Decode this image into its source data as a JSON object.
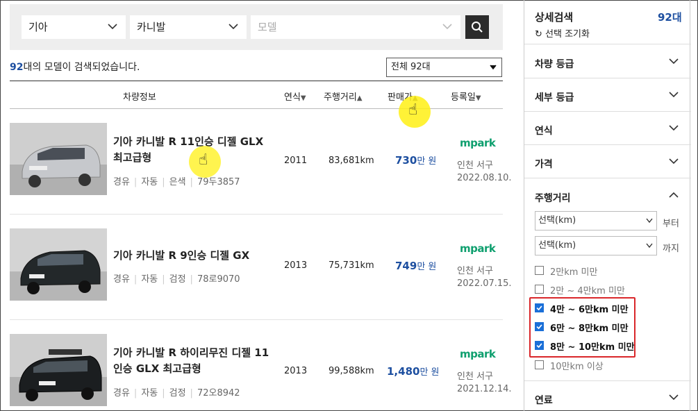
{
  "filters": {
    "maker": "기아",
    "model_group": "카니발",
    "model_placeholder": "모델"
  },
  "results": {
    "count": "92",
    "suffix": "대의 모델이 검색되었습니다.",
    "total_select": "전체 92대"
  },
  "table_headers": {
    "info": "차량정보",
    "year": "연식",
    "mileage": "주행거리",
    "price": "판매가",
    "date": "등록일"
  },
  "listings": [
    {
      "title": "기아 카니발 R 11인승 디젤 GLX 최고급형",
      "fuel": "경유",
      "trans": "자동",
      "color": "은색",
      "plate": "79두3857",
      "year": "2011",
      "mileage": "83,681km",
      "price": "730",
      "price_unit": "만 원",
      "dealer": "mpark",
      "location": "인천 서구",
      "date": "2022.08.10."
    },
    {
      "title": "기아 카니발 R 9인승 디젤 GX",
      "fuel": "경유",
      "trans": "자동",
      "color": "검정",
      "plate": "78로9070",
      "year": "2013",
      "mileage": "75,731km",
      "price": "749",
      "price_unit": "만 원",
      "dealer": "mpark",
      "location": "인천 서구",
      "date": "2022.07.15."
    },
    {
      "title": "기아 카니발 R 하이리무진 디젤 11인승 GLX 최고급형",
      "fuel": "경유",
      "trans": "자동",
      "color": "검정",
      "plate": "72오8942",
      "year": "2013",
      "mileage": "99,588km",
      "price": "1,480",
      "price_unit": "만 원",
      "dealer": "mpark",
      "location": "인천 서구",
      "date": "2021.12.14."
    }
  ],
  "sidebar": {
    "title": "상세검색",
    "count": "92대",
    "reset": "선택 조기화",
    "sections": [
      "차량 등급",
      "세부 등급",
      "연식",
      "가격",
      "주행거리",
      "연료"
    ],
    "mileage_from": "선택(km)",
    "mileage_from_suffix": "부터",
    "mileage_to": "선택(km)",
    "mileage_to_suffix": "까지",
    "mileage_options": [
      {
        "label": "2만km 미만",
        "checked": false
      },
      {
        "label": "2만 ~ 4만km 미만",
        "checked": false
      },
      {
        "label": "4만 ~ 6만km 미만",
        "checked": true
      },
      {
        "label": "6만 ~ 8만km 미만",
        "checked": true
      },
      {
        "label": "8만 ~ 10만km 미만",
        "checked": true
      },
      {
        "label": "10만km 이상",
        "checked": false
      }
    ]
  },
  "colors": {
    "accent": "#1d4fa0",
    "brand_green": "#0e9f6e",
    "check_blue": "#1a6fd8",
    "highlight_red": "#d9262a"
  }
}
